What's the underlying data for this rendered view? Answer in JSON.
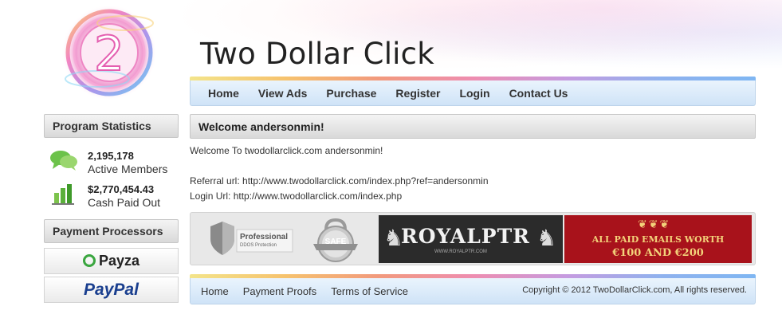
{
  "site": {
    "title": "Two Dollar Click",
    "logo_text": "2"
  },
  "nav": {
    "items": [
      "Home",
      "View Ads",
      "Purchase",
      "Register",
      "Login",
      "Contact Us"
    ]
  },
  "sidebar": {
    "stats_heading": "Program Statistics",
    "stats": [
      {
        "value": "2,195,178",
        "label": "Active Members",
        "icon": "chat-bubbles-icon"
      },
      {
        "value": "$2,770,454.43",
        "label": "Cash Paid Out",
        "icon": "bar-chart-icon"
      }
    ],
    "processors_heading": "Payment Processors",
    "processors": [
      "Payza",
      "PayPal"
    ]
  },
  "main": {
    "welcome_heading": "Welcome andersonmin!",
    "welcome_text": "Welcome To twodollarclick.com andersonmin!",
    "referral": "Referral url: http://www.twodollarclick.com/index.php?ref=andersonmin",
    "login_url": "Login Url: http://www.twodollarclick.com/index.php"
  },
  "banners": {
    "ddos_line1": "Professional",
    "ddos_line2": "DDOS Protection",
    "safe": "SAFE",
    "royal": "ROYALPTR",
    "royal_sub": "WWW.ROYALPTR.COM",
    "promo_line1": "ALL PAID EMAILS WORTH",
    "promo_line2": "€100 AND €200"
  },
  "footer": {
    "links": [
      "Home",
      "Payment Proofs",
      "Terms of Service"
    ],
    "copyright": "Copyright © 2012 TwoDollarClick.com, All rights reserved."
  },
  "colors": {
    "nav_bg": "#cfe3f7",
    "royal_bg": "#2b2b2b",
    "promo_bg": "#a8121b",
    "promo_text": "#f3d27a",
    "paypal_blue": "#1a3f8f",
    "payza_green": "#3aa63f"
  }
}
